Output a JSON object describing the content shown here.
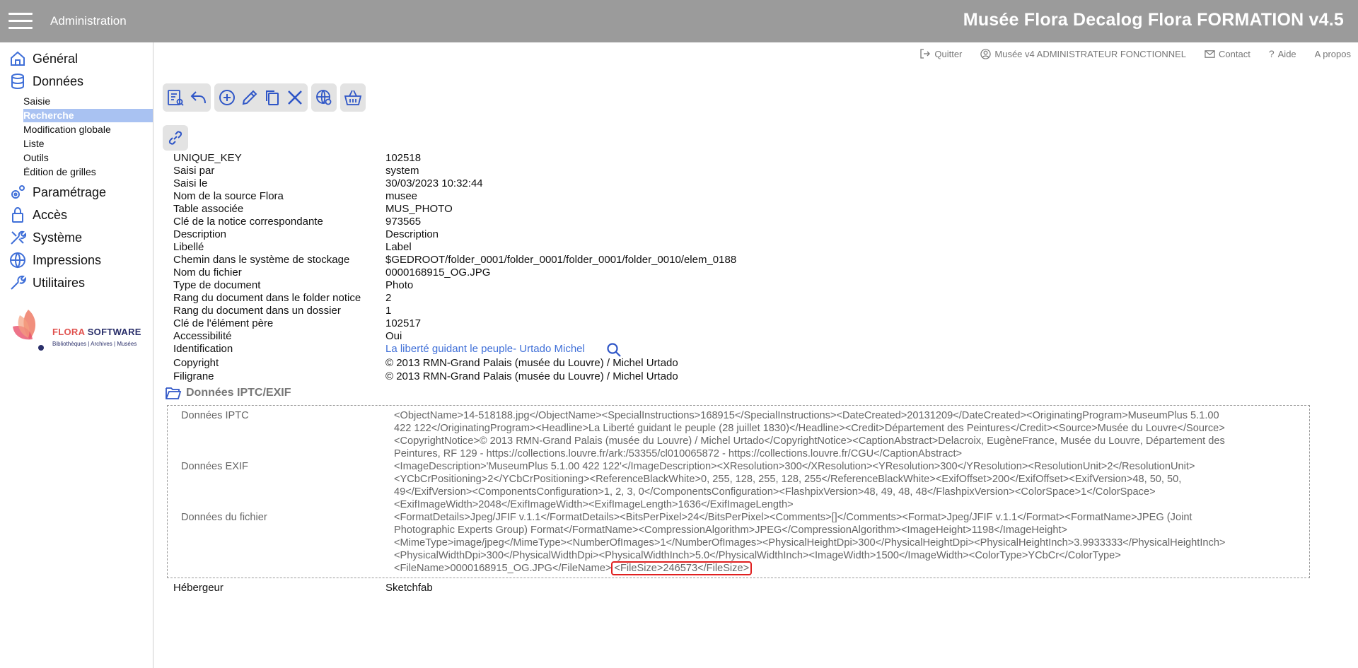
{
  "header": {
    "left_title": "Administration",
    "right_title": "Musée Flora Decalog Flora FORMATION v4.5"
  },
  "sidebar": {
    "items": [
      {
        "label": "Général",
        "icon": "home-icon"
      },
      {
        "label": "Données",
        "icon": "database-icon"
      },
      {
        "label": "Paramétrage",
        "icon": "settings-icon"
      },
      {
        "label": "Accès",
        "icon": "lock-icon"
      },
      {
        "label": "Système",
        "icon": "tools-icon"
      },
      {
        "label": "Impressions",
        "icon": "globe-icon"
      },
      {
        "label": "Utilitaires",
        "icon": "wrench-icon"
      }
    ],
    "subitems": [
      "Saisie",
      "Recherche",
      "Modification globale",
      "Liste",
      "Outils",
      "Édition de grilles"
    ],
    "active_subitem": "Recherche"
  },
  "logo": {
    "brand_a": "FLORA",
    "brand_b": " SOFTWARE",
    "tagline": "Bibliothèques | Archives | Musées"
  },
  "toplinks": {
    "quit": "Quitter",
    "user": "Musée v4 ADMINISTRATEUR FONCTIONNEL",
    "contact": "Contact",
    "help": "Aide",
    "about": "A propos"
  },
  "fields": [
    {
      "label": "UNIQUE_KEY",
      "value": "102518"
    },
    {
      "label": "Saisi par",
      "value": "system"
    },
    {
      "label": "Saisi le",
      "value": "30/03/2023 10:32:44"
    },
    {
      "label": "Nom de la source Flora",
      "value": "musee"
    },
    {
      "label": "Table associée",
      "value": "MUS_PHOTO"
    },
    {
      "label": "Clé de la notice correspondante",
      "value": "973565"
    },
    {
      "label": "Description",
      "value": "Description"
    },
    {
      "label": "Libellé",
      "value": "Label"
    },
    {
      "label": "Chemin dans le système de stockage",
      "value": "$GEDROOT/folder_0001/folder_0001/folder_0001/folder_0010/elem_0188"
    },
    {
      "label": "Nom du fichier",
      "value": "0000168915_OG.JPG"
    },
    {
      "label": "Type de document",
      "value": "Photo"
    },
    {
      "label": "Rang du document dans le folder notice",
      "value": "2"
    },
    {
      "label": "Rang du document dans un dossier",
      "value": "1"
    },
    {
      "label": "Clé de l'élément père",
      "value": "102517"
    },
    {
      "label": "Accessibilité",
      "value": "Oui"
    },
    {
      "label": "Identification",
      "value": "La liberté guidant le peuple- Urtado Michel"
    },
    {
      "label": "Copyright",
      "value": "© 2013 RMN-Grand Palais (musée du Louvre) / Michel Urtado"
    },
    {
      "label": "Filigrane",
      "value": "© 2013 RMN-Grand Palais (musée du Louvre) / Michel Urtado"
    }
  ],
  "section_title": "Données IPTC/EXIF",
  "exif": {
    "iptc_label": "Données IPTC",
    "iptc_lines": [
      "<ObjectName>14-518188.jpg</ObjectName><SpecialInstructions>168915</SpecialInstructions><DateCreated>20131209</DateCreated><OriginatingProgram>MuseumPlus 5.1.00",
      "422 122</OriginatingProgram><Headline>La Liberté guidant le peuple (28 juillet 1830)</Headline><Credit>Département des Peintures</Credit><Source>Musée du Louvre</Source>",
      "<CopyrightNotice>© 2013 RMN-Grand Palais (musée du Louvre) / Michel Urtado</CopyrightNotice><CaptionAbstract>Delacroix, EugèneFrance, Musée du Louvre, Département des",
      "Peintures, RF 129 - https://collections.louvre.fr/ark:/53355/cl010065872 - https://collections.louvre.fr/CGU</CaptionAbstract>"
    ],
    "exif_label": "Données EXIF",
    "exif_lines": [
      "<ImageDescription>'MuseumPlus 5.1.00 422 122'</ImageDescription><XResolution>300</XResolution><YResolution>300</YResolution><ResolutionUnit>2</ResolutionUnit>",
      "<YCbCrPositioning>2</YCbCrPositioning><ReferenceBlackWhite>0, 255, 128, 255, 128, 255</ReferenceBlackWhite><ExifOffset>200</ExifOffset><ExifVersion>48, 50, 50,",
      "49</ExifVersion><ComponentsConfiguration>1, 2, 3, 0</ComponentsConfiguration><FlashpixVersion>48, 49, 48, 48</FlashpixVersion><ColorSpace>1</ColorSpace>",
      "<ExifImageWidth>2048</ExifImageWidth><ExifImageLength>1636</ExifImageLength>"
    ],
    "file_label": "Données du fichier",
    "file_lines": [
      "<FormatDetails>Jpeg/JFIF v.1.1</FormatDetails><BitsPerPixel>24</BitsPerPixel><Comments>[]</Comments><Format>Jpeg/JFIF v.1.1</Format><FormatName>JPEG (Joint",
      "Photographic Experts Group) Format</FormatName><CompressionAlgorithm>JPEG</CompressionAlgorithm><ImageHeight>1198</ImageHeight>",
      "<MimeType>image/jpeg</MimeType><NumberOfImages>1</NumberOfImages><PhysicalHeightDpi>300</PhysicalHeightDpi><PhysicalHeightInch>3.9933333</PhysicalHeightInch>",
      "<PhysicalWidthDpi>300</PhysicalWidthDpi><PhysicalWidthInch>5.0</PhysicalWidthInch><ImageWidth>1500</ImageWidth><ColorType>YCbCr</ColorType>"
    ],
    "file_last_line": "<FileName>0000168915_OG.JPG</FileName>",
    "file_highlight": "<FileSize>246573</FileSize>"
  },
  "hebergeur": {
    "label": "Hébergeur",
    "value": "Sketchfab"
  }
}
